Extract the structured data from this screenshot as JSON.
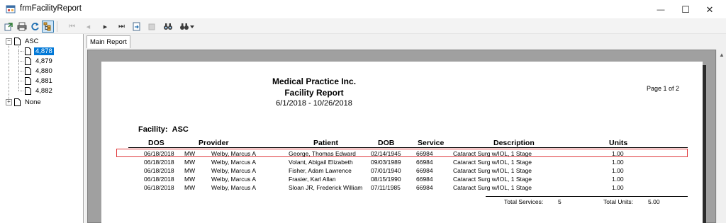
{
  "window": {
    "title": "frmFacilityReport",
    "minimize_glyph": "—",
    "maximize_glyph": "☐",
    "close_glyph": "✕"
  },
  "toolbar": {
    "buttons": [
      {
        "name": "export-icon"
      },
      {
        "name": "print-icon"
      },
      {
        "name": "refresh-icon"
      },
      {
        "name": "group-tree-icon"
      },
      {
        "name": "first-page-icon",
        "glyph": "⏮"
      },
      {
        "name": "previous-page-icon",
        "glyph": "◀"
      },
      {
        "name": "next-page-icon",
        "glyph": "▶"
      },
      {
        "name": "last-page-icon",
        "glyph": "⏭"
      },
      {
        "name": "goto-page-icon"
      },
      {
        "name": "stop-icon"
      },
      {
        "name": "find-icon"
      },
      {
        "name": "zoom-icon"
      }
    ]
  },
  "tree": {
    "root": {
      "label": "ASC",
      "expander": "−"
    },
    "children": [
      "4,878",
      "4,879",
      "4,880",
      "4,881",
      "4,882"
    ],
    "selected_index": 0,
    "other": {
      "label": "None",
      "expander": "+"
    }
  },
  "tabs": [
    {
      "label": "Main Report"
    }
  ],
  "report": {
    "company": "Medical Practice Inc.",
    "title": "Facility Report",
    "date_range": "6/1/2018 - 10/26/2018",
    "page_label": "Page 1 of 2",
    "facility_label": "Facility:",
    "facility_value": "ASC",
    "columns": [
      "DOS",
      "Provider",
      "Patient",
      "DOB",
      "Service",
      "Description",
      "Units"
    ],
    "rows": [
      {
        "dos": "06/18/2018",
        "code": "MW",
        "provider": "Welby, Marcus A",
        "patient": "George, Thomas Edward",
        "dob": "02/14/1945",
        "service": "66984",
        "description": "Cataract Surg w/IOL, 1 Stage",
        "units": "1.00"
      },
      {
        "dos": "06/18/2018",
        "code": "MW",
        "provider": "Welby, Marcus A",
        "patient": "Volant, Abigail Elizabeth",
        "dob": "09/03/1989",
        "service": "66984",
        "description": "Cataract Surg w/IOL, 1 Stage",
        "units": "1.00"
      },
      {
        "dos": "06/18/2018",
        "code": "MW",
        "provider": "Welby, Marcus A",
        "patient": "Fisher, Adam Lawrence",
        "dob": "07/01/1940",
        "service": "66984",
        "description": "Cataract Surg w/IOL, 1 Stage",
        "units": "1.00"
      },
      {
        "dos": "06/18/2018",
        "code": "MW",
        "provider": "Welby, Marcus A",
        "patient": "Frasier, Karl Allan",
        "dob": "08/15/1990",
        "service": "66984",
        "description": "Cataract Surg w/IOL, 1 Stage",
        "units": "1.00"
      },
      {
        "dos": "06/18/2018",
        "code": "MW",
        "provider": "Welby, Marcus A",
        "patient": "Sloan JR, Frederick William",
        "dob": "07/11/1985",
        "service": "66984",
        "description": "Cataract Surg w/IOL, 1 Stage",
        "units": "1.00"
      }
    ],
    "highlighted_row": 0,
    "highlight_color": "#e0393c",
    "totals": {
      "services_label": "Total Services:",
      "services_value": "5",
      "units_label": "Total Units:",
      "units_value": "5.00"
    }
  },
  "colors": {
    "selection": "#0078d7",
    "viewer_background": "#a0a0a0"
  }
}
